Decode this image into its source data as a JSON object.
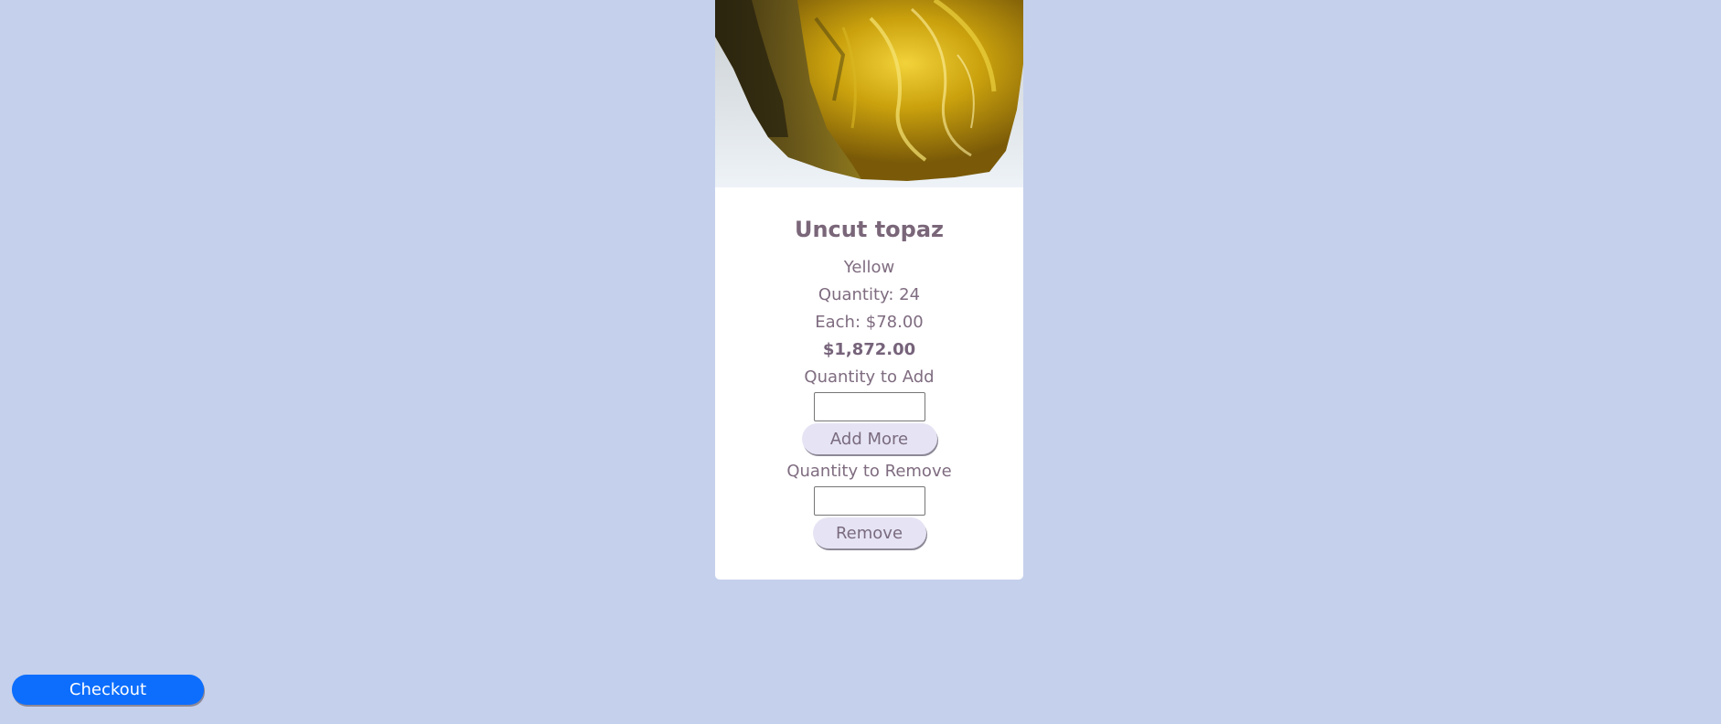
{
  "product": {
    "name": "Uncut topaz",
    "color": "Yellow",
    "quantity": "Quantity: 24",
    "each": "Each: $78.00",
    "total": "$1,872.00",
    "add_label": "Quantity to Add",
    "add_button": "Add More",
    "remove_label": "Quantity to Remove",
    "remove_button": "Remove",
    "image_subject": "yellow topaz crystal photo"
  },
  "checkout": {
    "label": "Checkout",
    "color": "#0d6efd"
  },
  "colors": {
    "background": "#c5d0ec",
    "card": "#ffffff",
    "text": "#7f6c80",
    "button_bg": "#e6e4f4"
  }
}
